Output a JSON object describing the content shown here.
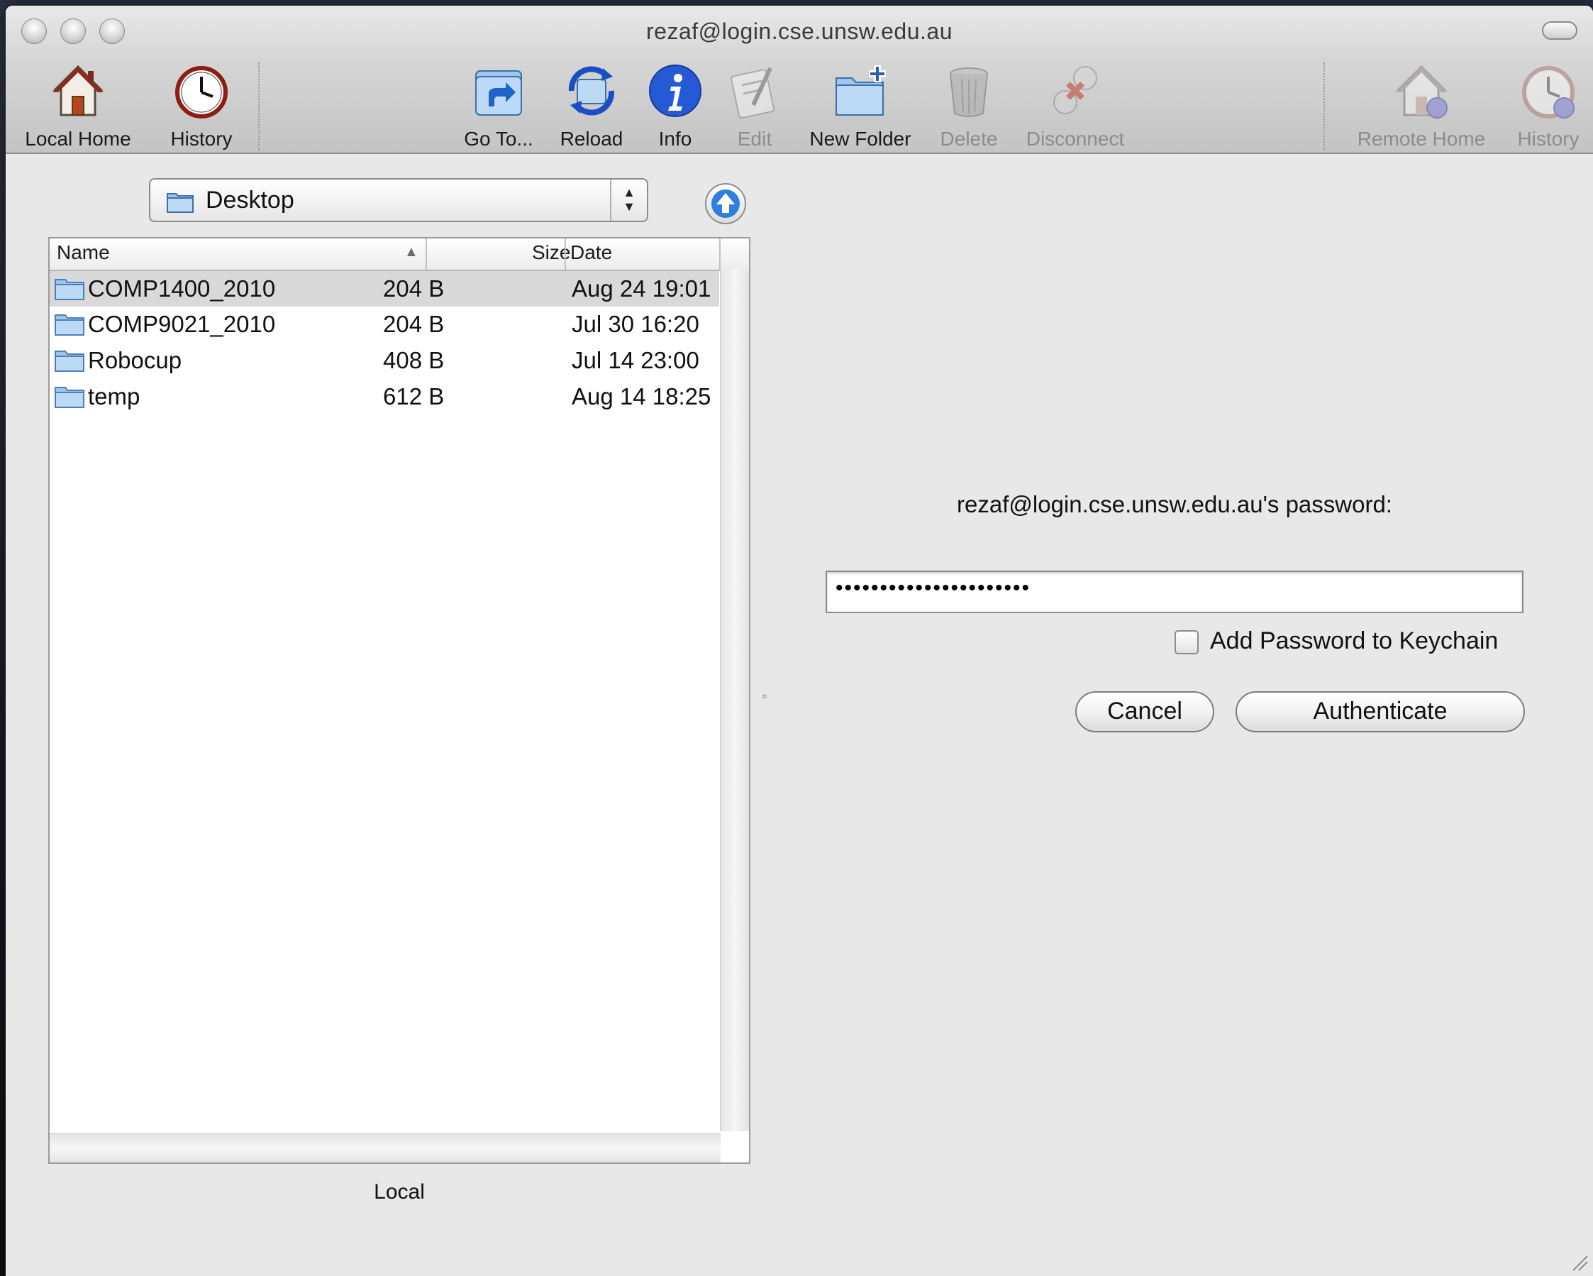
{
  "window": {
    "title": "rezaf@login.cse.unsw.edu.au"
  },
  "toolbar": {
    "local_home": "Local Home",
    "history_left": "History",
    "goto": "Go To...",
    "reload": "Reload",
    "info": "Info",
    "edit": "Edit",
    "new_folder": "New Folder",
    "delete": "Delete",
    "disconnect": "Disconnect",
    "remote_home": "Remote Home",
    "history_right": "History"
  },
  "local": {
    "location": "Desktop",
    "columns": {
      "name": "Name",
      "size": "Size",
      "date": "Date"
    },
    "rows": [
      {
        "name": "COMP1400_2010",
        "size": "204 B",
        "date": "Aug 24 19:01",
        "selected": true
      },
      {
        "name": "COMP9021_2010",
        "size": "204 B",
        "date": "Jul 30 16:20",
        "selected": false
      },
      {
        "name": "Robocup",
        "size": "408 B",
        "date": "Jul 14 23:00",
        "selected": false
      },
      {
        "name": "temp",
        "size": "612 B",
        "date": "Aug 14 18:25",
        "selected": false
      }
    ],
    "pane_label": "Local"
  },
  "auth": {
    "prompt": "rezaf@login.cse.unsw.edu.au's password:",
    "password_masked": "••••••••••••••••••••••",
    "keychain_label": "Add Password to Keychain",
    "keychain_checked": false,
    "cancel_label": "Cancel",
    "authenticate_label": "Authenticate"
  }
}
